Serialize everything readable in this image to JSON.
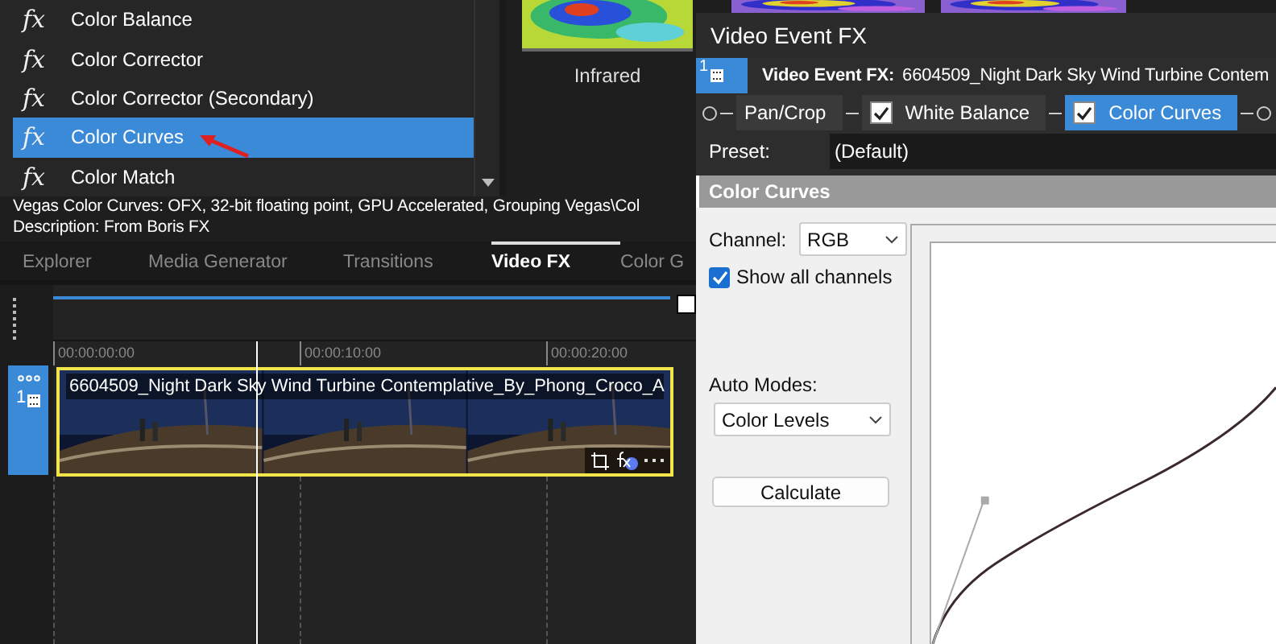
{
  "effects_list": {
    "items": [
      {
        "icon": "fx",
        "label": "Color Balance",
        "selected": false
      },
      {
        "icon": "fx",
        "label": "Color Corrector",
        "selected": false
      },
      {
        "icon": "fx",
        "label": "Color Corrector (Secondary)",
        "selected": false
      },
      {
        "icon": "fx",
        "label": "Color Curves",
        "selected": true
      },
      {
        "icon": "fx",
        "label": "Color Match",
        "selected": false
      }
    ]
  },
  "preset_preview": {
    "label": "Infrared"
  },
  "info": {
    "line_1": "Vegas Color Curves: OFX, 32-bit floating point, GPU Accelerated, Grouping Vegas\\Col",
    "line_2": "Description: From Boris FX"
  },
  "tabs": [
    {
      "label": "Explorer",
      "selected": false
    },
    {
      "label": "Media Generator",
      "selected": false
    },
    {
      "label": "Transitions",
      "selected": false
    },
    {
      "label": "Video FX",
      "selected": true
    },
    {
      "label": "Color G",
      "selected": false
    }
  ],
  "timeline": {
    "ruler": [
      "00:00:00:00",
      "00:00:10:00",
      "00:00:20:00"
    ],
    "track_number": "1",
    "clip": {
      "title": "6604509_Night Dark Sky Wind Turbine Contemplative_By_Phong_Croco_A",
      "selected": true
    }
  },
  "dialog": {
    "title": "Video Event FX",
    "track_number": "1",
    "event_label": "Video Event FX:",
    "event_name": "6604509_Night Dark Sky Wind Turbine Contem",
    "chain": [
      {
        "label": "Pan/Crop",
        "kind": "plain",
        "selected": false
      },
      {
        "label": "White Balance",
        "kind": "checkbox",
        "checked": true,
        "selected": false
      },
      {
        "label": "Color Curves",
        "kind": "checkbox",
        "checked": true,
        "selected": true
      }
    ],
    "preset_label": "Preset:",
    "preset_value": "(Default)",
    "panel_title": "Color Curves",
    "channel_label": "Channel:",
    "channel_value": "RGB",
    "show_all_channels": {
      "label": "Show all channels",
      "checked": true
    },
    "auto_modes_label": "Auto Modes:",
    "auto_modes_value": "Color Levels",
    "calculate_button": "Calculate"
  }
}
